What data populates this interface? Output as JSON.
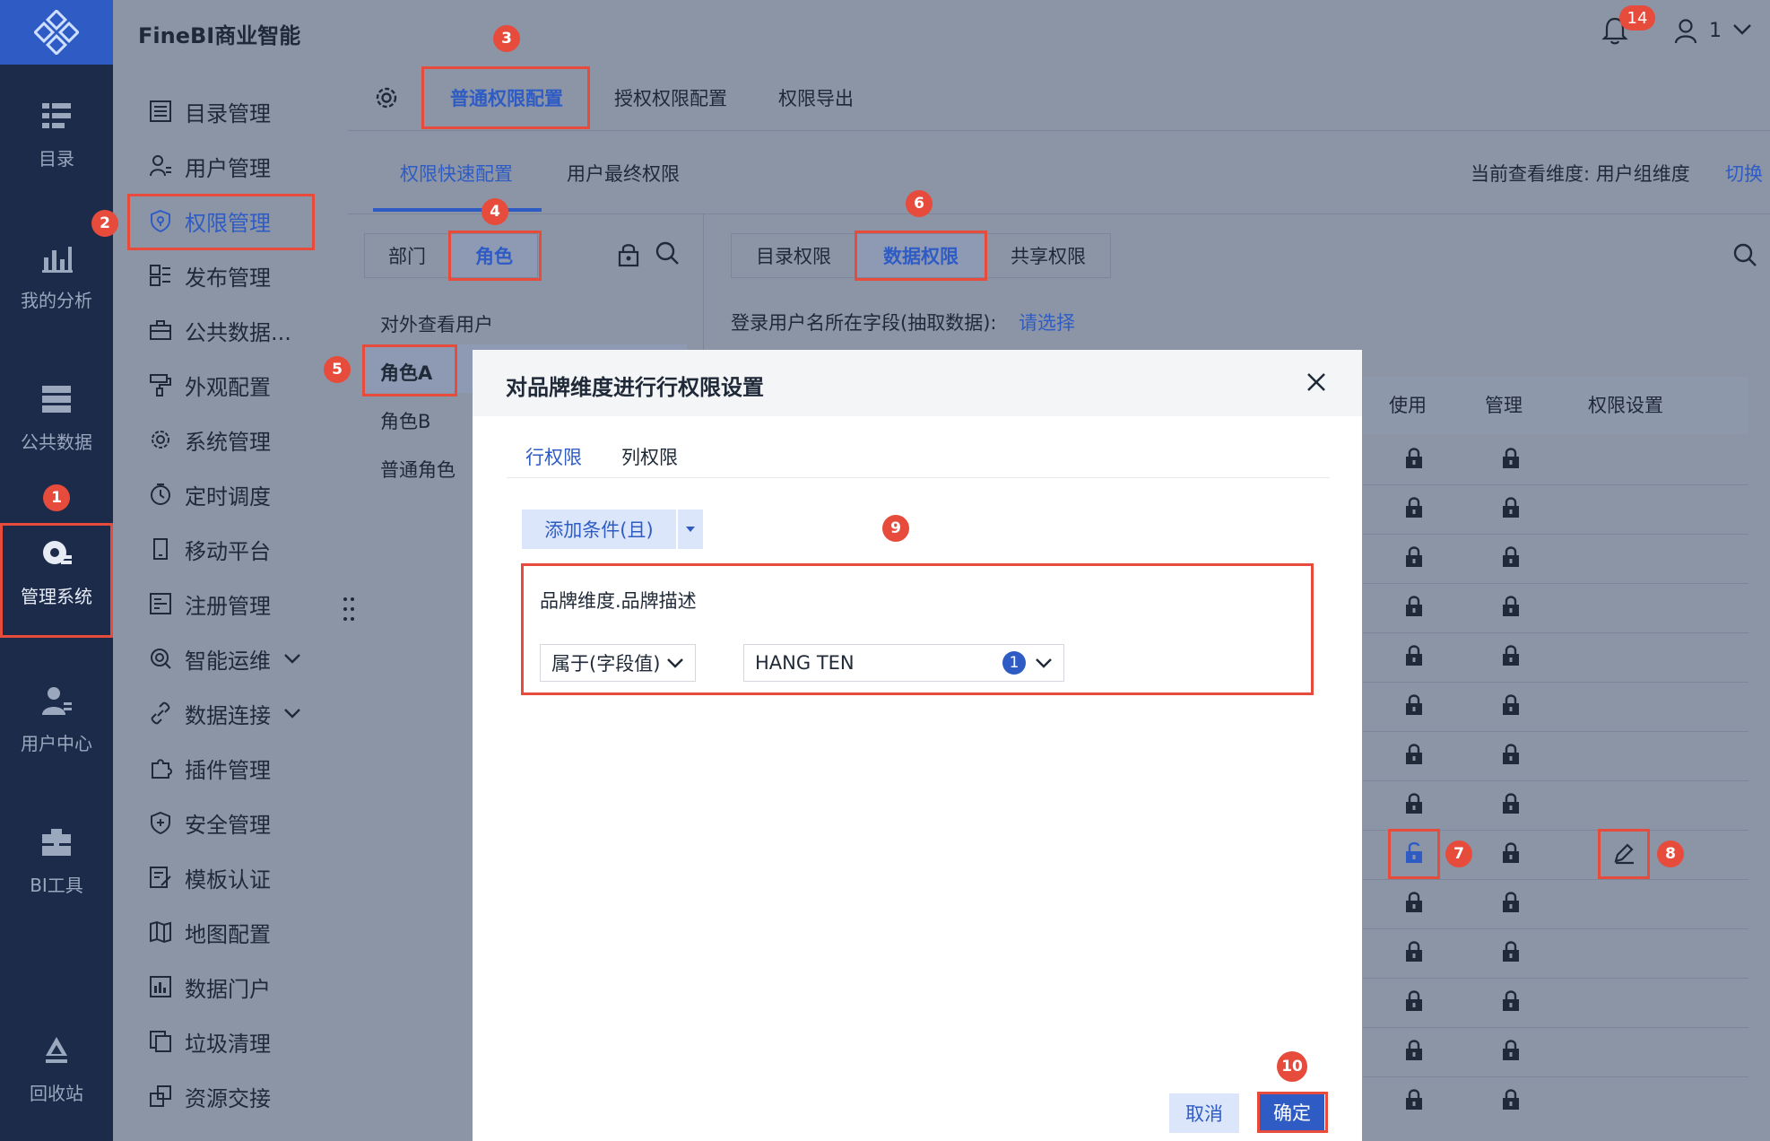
{
  "app": {
    "title": "FineBI商业智能"
  },
  "header": {
    "notification_count": "14",
    "user_label": "1"
  },
  "rail": {
    "items": [
      {
        "label": "目录"
      },
      {
        "label": "我的分析"
      },
      {
        "label": "公共数据"
      },
      {
        "label": "管理系统"
      },
      {
        "label": "用户中心"
      },
      {
        "label": "BI工具"
      },
      {
        "label": "回收站"
      }
    ]
  },
  "menu": {
    "items": [
      {
        "label": "目录管理"
      },
      {
        "label": "用户管理"
      },
      {
        "label": "权限管理"
      },
      {
        "label": "发布管理"
      },
      {
        "label": "公共数据..."
      },
      {
        "label": "外观配置"
      },
      {
        "label": "系统管理"
      },
      {
        "label": "定时调度"
      },
      {
        "label": "移动平台"
      },
      {
        "label": "注册管理"
      },
      {
        "label": "智能运维"
      },
      {
        "label": "数据连接"
      },
      {
        "label": "插件管理"
      },
      {
        "label": "安全管理"
      },
      {
        "label": "模板认证"
      },
      {
        "label": "地图配置"
      },
      {
        "label": "数据门户"
      },
      {
        "label": "垃圾清理"
      },
      {
        "label": "资源交接"
      }
    ]
  },
  "topnav": {
    "tabs": [
      {
        "label": "普通权限配置"
      },
      {
        "label": "授权权限配置"
      },
      {
        "label": "权限导出"
      }
    ]
  },
  "subnav": {
    "tabs": [
      {
        "label": "权限快速配置"
      },
      {
        "label": "用户最终权限"
      }
    ],
    "dimension_label": "当前查看维度: 用户组维度",
    "switch_label": "切换"
  },
  "left_panel": {
    "segments": [
      {
        "label": "部门"
      },
      {
        "label": "角色"
      }
    ],
    "roles": [
      {
        "label": "对外查看用户"
      },
      {
        "label": "角色A"
      },
      {
        "label": "角色B"
      },
      {
        "label": "普通角色"
      }
    ]
  },
  "right_panel": {
    "segments": [
      {
        "label": "目录权限"
      },
      {
        "label": "数据权限"
      },
      {
        "label": "共享权限"
      }
    ],
    "login_field_extract": "登录用户名所在字段(抽取数据):",
    "login_field_placeholder": "请选择",
    "table_headers": {
      "use": "使用",
      "manage": "管理",
      "settings": "权限设置"
    }
  },
  "annotations": [
    "1",
    "2",
    "3",
    "4",
    "5",
    "6",
    "7",
    "8",
    "9",
    "10"
  ],
  "modal": {
    "title": "对品牌维度进行行权限设置",
    "tabs": [
      {
        "label": "行权限"
      },
      {
        "label": "列权限"
      }
    ],
    "add_condition_label": "添加条件(且)",
    "condition": {
      "field": "品牌维度.品牌描述",
      "operator": "属于(字段值)",
      "value": "HANG TEN",
      "value_count": "1"
    },
    "cancel_label": "取消",
    "ok_label": "确定"
  }
}
